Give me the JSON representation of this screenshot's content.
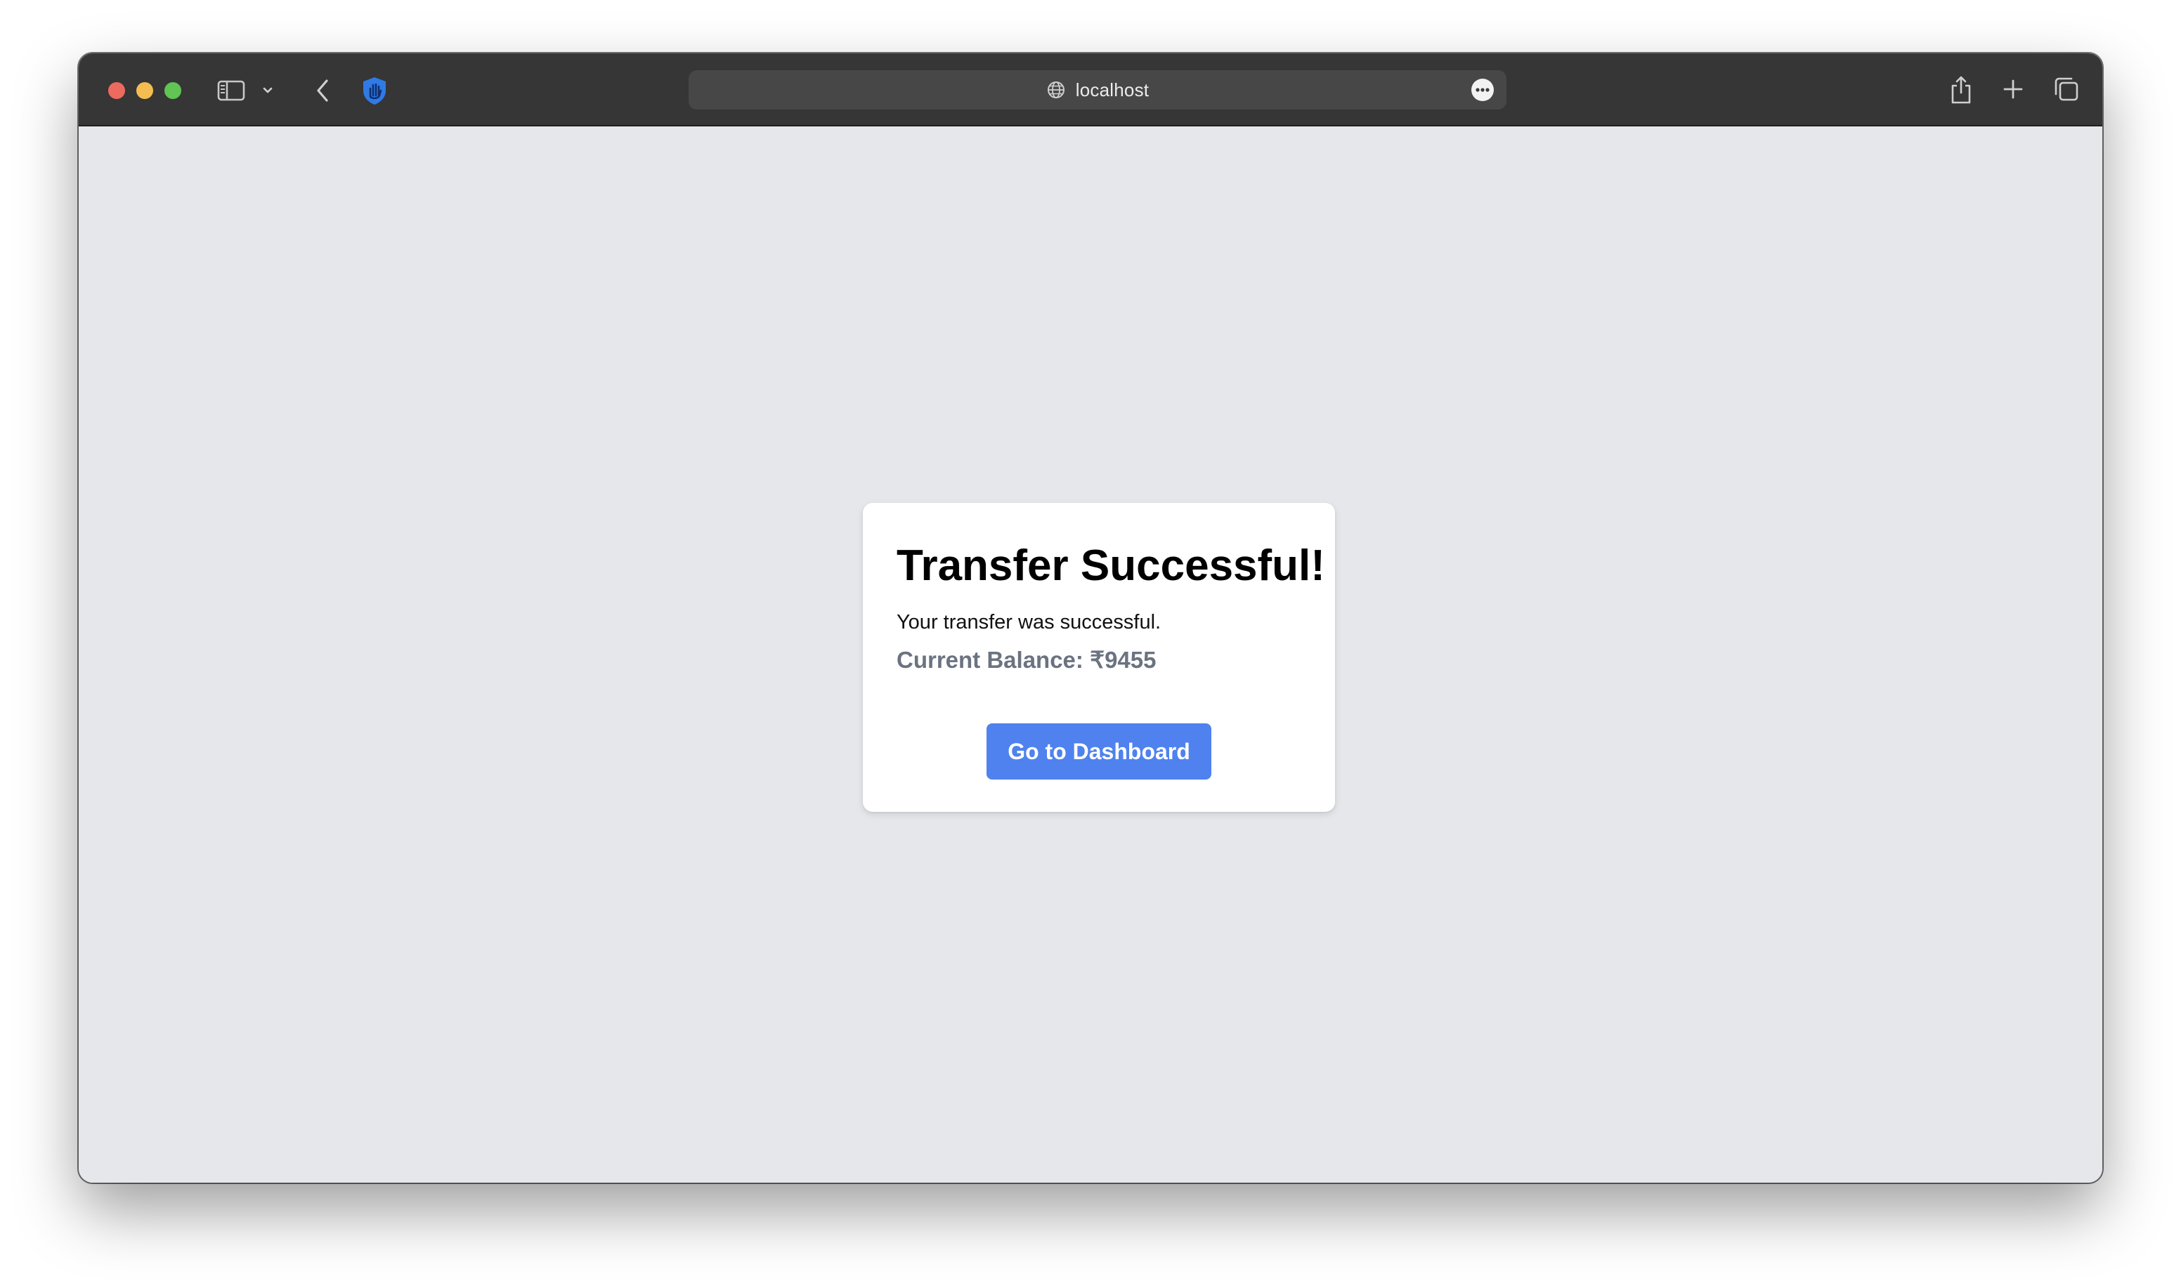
{
  "browser": {
    "url": "localhost",
    "icons": {
      "sidebar_toggle": "sidebar-icon",
      "sidebar_menu": "chevron-down-icon",
      "back": "chevron-left-icon",
      "extension": "hand-shield-icon",
      "site_info": "globe-icon",
      "page_menu": "ellipsis-icon",
      "share": "share-icon",
      "new_tab": "plus-icon",
      "tab_overview": "tabs-icon"
    },
    "colors": {
      "toolbar": "#363636",
      "address_bar": "#474747",
      "extension_accent": "#2f7ae5"
    }
  },
  "page": {
    "background": "#e5e7eb",
    "card": {
      "title": "Transfer Successful!",
      "message": "Your transfer was successful.",
      "balance": "Current Balance: ₹9455",
      "button_label": "Go to Dashboard"
    },
    "colors": {
      "button": "#4f82ee",
      "balance_text": "#6b7280"
    }
  }
}
